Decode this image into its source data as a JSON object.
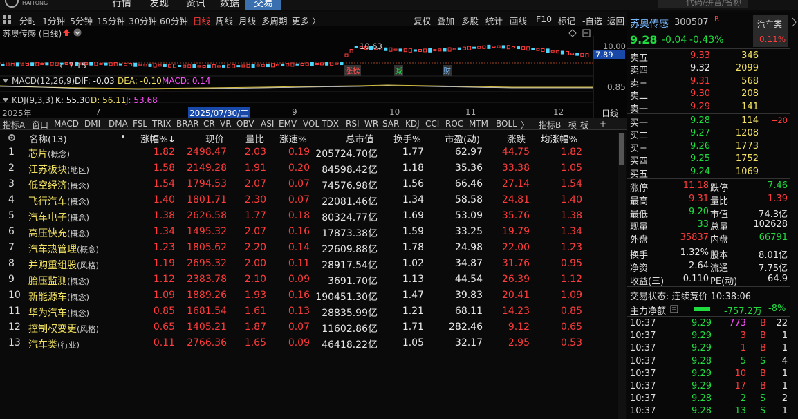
{
  "topnav": {
    "logo": "HAITONG",
    "items": [
      "行情",
      "发现",
      "资讯",
      "数据",
      "交易"
    ],
    "search_placeholder": "代码/拼音/名称"
  },
  "periodbar": {
    "items": [
      "分时",
      "1分钟",
      "5分钟",
      "15分钟",
      "30分钟",
      "60分钟",
      "日线",
      "周线",
      "月线",
      "多周期",
      "更多 〉"
    ],
    "active": "日线",
    "right_items": [
      "复权",
      "叠加",
      "多股",
      "统计",
      "画线",
      "F10",
      "标记",
      "-自选",
      "返回"
    ]
  },
  "chart": {
    "title": "苏奥传感 (日线)",
    "y_labels": [
      "10.00",
      "7.89"
    ],
    "price_low": "← 7.15",
    "price_high": "10.63",
    "markers": [
      "涨榜",
      "减",
      "财"
    ],
    "macd_label": "MACD(12,26,9)",
    "macd_dif": "DIF: -0.03",
    "macd_dea": "DEA: -0.10",
    "macd_val": "MACD: 0.14",
    "macd_y": "0.85",
    "kdj_label": "KDJ(9,3,3)",
    "kdj_k": "K: 55.30",
    "kdj_d": "D: 56.11",
    "kdj_j": "J: 53.68",
    "date_labels": [
      "2025年",
      "7",
      "2025/07/30/三",
      "9",
      "10",
      "11",
      "12",
      "日线"
    ]
  },
  "indtabs": {
    "items": [
      "指标A",
      "窗口",
      "MACD",
      "DMI",
      "DMA",
      "FSL",
      "TRIX",
      "BRAR",
      "CR",
      "VR",
      "OBV",
      "ASI",
      "EMV",
      "VOL-TDX",
      "RSI",
      "WR",
      "SAR",
      "KDJ",
      "CCI",
      "ROC",
      "MTM",
      "BOLL",
      "〉",
      "指标B",
      "模",
      "板",
      "+",
      "-"
    ],
    "active": "KDJ"
  },
  "table": {
    "headers": [
      "名称(13)",
      "•",
      "涨幅%↓",
      "现价",
      "量比",
      "涨速%",
      "总市值",
      "换手%",
      "市盈(动)",
      "涨跌",
      "均涨幅%"
    ],
    "rows": [
      {
        "idx": "1",
        "name": "芯片",
        "tag": "(概念)",
        "chg": "1.82",
        "price": "2498.47",
        "vr": "2.03",
        "speed": "0.19",
        "mcap": "205724.70亿",
        "turn": "1.77",
        "pe": "62.97",
        "diff": "44.75",
        "avg": "1.82"
      },
      {
        "idx": "2",
        "name": "江苏板块",
        "tag": "(地区)",
        "chg": "1.58",
        "price": "2149.28",
        "vr": "1.91",
        "speed": "0.20",
        "mcap": "84598.42亿",
        "turn": "1.18",
        "pe": "35.36",
        "diff": "33.38",
        "avg": "1.05"
      },
      {
        "idx": "3",
        "name": "低空经济",
        "tag": "(概念)",
        "chg": "1.54",
        "price": "1794.53",
        "vr": "2.07",
        "speed": "0.07",
        "mcap": "74576.98亿",
        "turn": "1.56",
        "pe": "66.46",
        "diff": "27.14",
        "avg": "1.54"
      },
      {
        "idx": "4",
        "name": "飞行汽车",
        "tag": "(概念)",
        "chg": "1.40",
        "price": "1801.71",
        "vr": "2.30",
        "speed": "0.07",
        "mcap": "22081.46亿",
        "turn": "1.34",
        "pe": "58.58",
        "diff": "24.81",
        "avg": "1.40"
      },
      {
        "idx": "5",
        "name": "汽车电子",
        "tag": "(概念)",
        "chg": "1.38",
        "price": "2626.58",
        "vr": "1.77",
        "speed": "0.18",
        "mcap": "80324.77亿",
        "turn": "1.69",
        "pe": "53.09",
        "diff": "35.76",
        "avg": "1.38"
      },
      {
        "idx": "6",
        "name": "高压快充",
        "tag": "(概念)",
        "chg": "1.34",
        "price": "1495.32",
        "vr": "2.07",
        "speed": "0.16",
        "mcap": "17873.38亿",
        "turn": "1.59",
        "pe": "33.25",
        "diff": "19.79",
        "avg": "1.34"
      },
      {
        "idx": "7",
        "name": "汽车热管理",
        "tag": "(概念)",
        "chg": "1.23",
        "price": "1805.62",
        "vr": "2.20",
        "speed": "0.14",
        "mcap": "22609.88亿",
        "turn": "1.78",
        "pe": "24.98",
        "diff": "22.00",
        "avg": "1.23"
      },
      {
        "idx": "8",
        "name": "并购重组股",
        "tag": "(风格)",
        "chg": "1.19",
        "price": "2695.32",
        "vr": "2.00",
        "speed": "0.11",
        "mcap": "28917.54亿",
        "turn": "1.02",
        "pe": "34.87",
        "diff": "31.76",
        "avg": "0.95"
      },
      {
        "idx": "9",
        "name": "胎压监测",
        "tag": "(概念)",
        "chg": "1.12",
        "price": "2383.78",
        "vr": "2.10",
        "speed": "0.09",
        "mcap": "3691.70亿",
        "turn": "1.13",
        "pe": "44.54",
        "diff": "26.39",
        "avg": "1.12"
      },
      {
        "idx": "10",
        "name": "新能源车",
        "tag": "(概念)",
        "chg": "1.09",
        "price": "1889.26",
        "vr": "1.93",
        "speed": "0.16",
        "mcap": "190451.30亿",
        "turn": "1.47",
        "pe": "39.83",
        "diff": "20.41",
        "avg": "1.09"
      },
      {
        "idx": "11",
        "name": "华为汽车",
        "tag": "(概念)",
        "chg": "0.85",
        "price": "1681.54",
        "vr": "1.61",
        "speed": "0.13",
        "mcap": "28835.99亿",
        "turn": "1.21",
        "pe": "68.11",
        "diff": "14.23",
        "avg": "0.85"
      },
      {
        "idx": "12",
        "name": "控制权变更",
        "tag": "(风格)",
        "chg": "0.65",
        "price": "1405.21",
        "vr": "1.87",
        "speed": "0.07",
        "mcap": "11602.86亿",
        "turn": "1.71",
        "pe": "282.46",
        "diff": "9.12",
        "avg": "0.65"
      },
      {
        "idx": "13",
        "name": "汽车类",
        "tag": "(行业)",
        "chg": "0.11",
        "price": "2766.36",
        "vr": "1.65",
        "speed": "0.09",
        "mcap": "46418.22亿",
        "turn": "1.05",
        "pe": "32.17",
        "diff": "2.95",
        "avg": "0.53"
      }
    ]
  },
  "quote": {
    "name": "苏奥传感",
    "code": "300507",
    "flag": "R",
    "price": "9.28",
    "change": "-0.04",
    "pct": "-0.43%",
    "sector": "汽车类",
    "sector_pct": "0.11%",
    "asks": [
      {
        "label": "卖五",
        "price": "9.33",
        "vol": "346"
      },
      {
        "label": "卖四",
        "price": "9.32",
        "vol": "2099"
      },
      {
        "label": "卖三",
        "price": "9.31",
        "vol": "568"
      },
      {
        "label": "卖二",
        "price": "9.30",
        "vol": "208"
      },
      {
        "label": "卖一",
        "price": "9.29",
        "vol": "141"
      }
    ],
    "bids": [
      {
        "label": "买一",
        "price": "9.28",
        "vol": "114",
        "extra": "+20"
      },
      {
        "label": "买二",
        "price": "9.27",
        "vol": "1208",
        "extra": ""
      },
      {
        "label": "买三",
        "price": "9.26",
        "vol": "1773",
        "extra": ""
      },
      {
        "label": "买四",
        "price": "9.25",
        "vol": "1752",
        "extra": ""
      },
      {
        "label": "买五",
        "price": "9.24",
        "vol": "1069",
        "extra": ""
      }
    ],
    "stats": [
      {
        "l1": "涨停",
        "v1": "11.18",
        "l2": "跌停",
        "v2": "7.46"
      },
      {
        "l1": "最高",
        "v1": "9.31",
        "l2": "量比",
        "v2": "1.39"
      },
      {
        "l1": "最低",
        "v1": "9.20",
        "l2": "市值",
        "v2": "74.3亿"
      },
      {
        "l1": "现量",
        "v1": "33",
        "l2": "总量",
        "v2": "102628"
      },
      {
        "l1": "外盘",
        "v1": "35837",
        "l2": "内盘",
        "v2": "66791"
      }
    ],
    "stats2": [
      {
        "l1": "换手",
        "v1": "1.32%",
        "l2": "股本",
        "v2": "8.01亿"
      },
      {
        "l1": "净资",
        "v1": "2.64",
        "l2": "流通",
        "v2": "7.75亿"
      },
      {
        "l1": "收益(三)",
        "v1": "0.110",
        "l2": "PE(动)",
        "v2": "64.9"
      }
    ],
    "status": "交易状态: 连续竞价 10:38:06",
    "netflow_label": "主力净额",
    "netflow_val": "-757.2万",
    "netflow_pct": "-8%",
    "ticks": [
      {
        "t": "10:37",
        "p": "9.29",
        "v": "773",
        "d": "B",
        "n": "22"
      },
      {
        "t": "10:37",
        "p": "9.29",
        "v": "3",
        "d": "B",
        "n": "1"
      },
      {
        "t": "10:37",
        "p": "9.29",
        "v": "1",
        "d": "B",
        "n": "1"
      },
      {
        "t": "10:37",
        "p": "9.28",
        "v": "5",
        "d": "S",
        "n": "4"
      },
      {
        "t": "10:37",
        "p": "9.29",
        "v": "10",
        "d": "B",
        "n": "1"
      },
      {
        "t": "10:37",
        "p": "9.29",
        "v": "17",
        "d": "B",
        "n": "1"
      },
      {
        "t": "10:37",
        "p": "9.28",
        "v": "2",
        "d": "S",
        "n": "2"
      },
      {
        "t": "10:37",
        "p": "9.28",
        "v": "13",
        "d": "S",
        "n": "1"
      }
    ]
  }
}
